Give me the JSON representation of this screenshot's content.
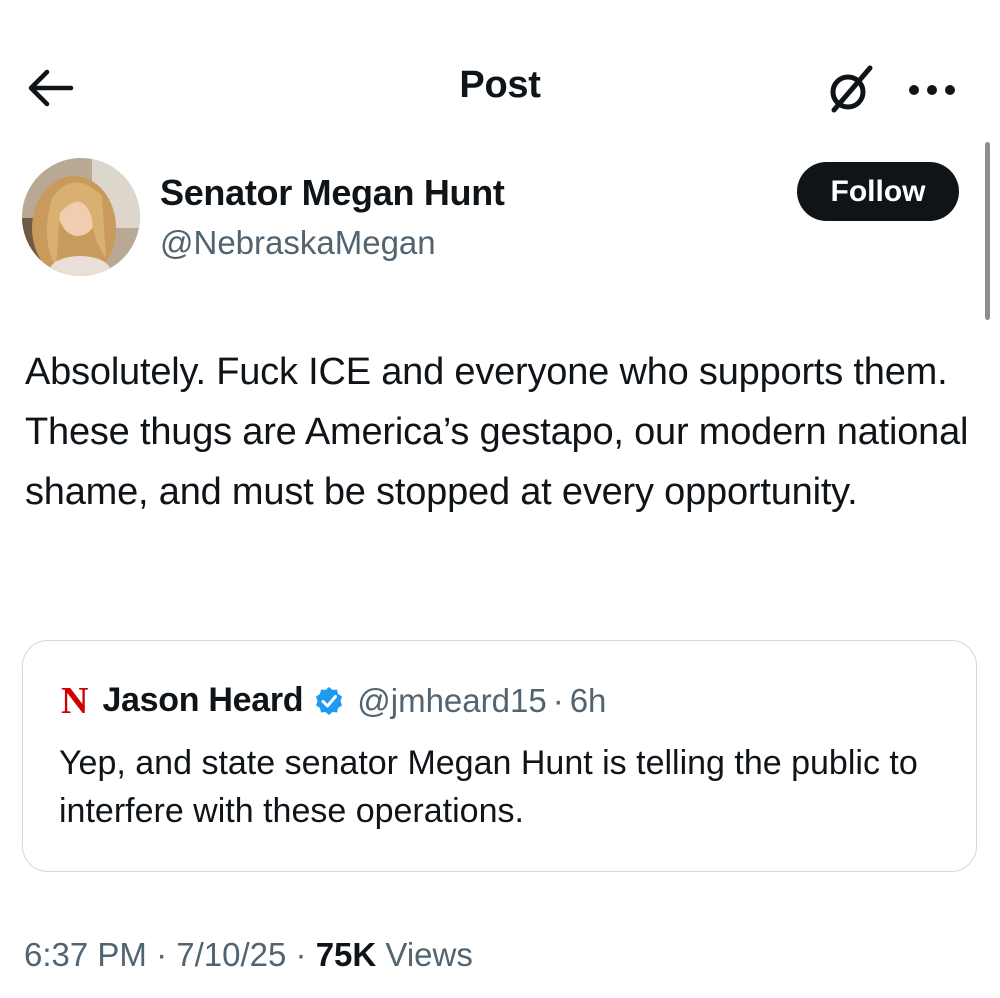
{
  "header": {
    "title": "Post",
    "back_icon": "arrow-left-icon",
    "grok_icon": "grok-slash-icon",
    "more_icon": "more-dots-icon"
  },
  "author": {
    "display_name": "Senator Megan Hunt",
    "handle": "@NebraskaMegan",
    "follow_label": "Follow"
  },
  "post": {
    "text": "Absolutely. Fuck ICE and everyone who supports them. These thugs are America’s gestapo, our modern national shame, and must be stopped at every opportunity."
  },
  "quote": {
    "logo_letter": "N",
    "name": "Jason Heard",
    "verified_icon": "verified-badge-icon",
    "handle": "@jmheard15",
    "separator": "·",
    "time": "6h",
    "text": "Yep, and state senator Megan Hunt is telling the public to interfere with these operations."
  },
  "meta": {
    "time": "6:37 PM",
    "sep1": "·",
    "date": "7/10/25",
    "sep2": "·",
    "views_count": "75K",
    "views_label": "Views"
  },
  "colors": {
    "text": "#0f1419",
    "muted": "#536471",
    "verified": "#1d9bf0",
    "n_logo": "#d00000",
    "border": "#cfd9de"
  }
}
